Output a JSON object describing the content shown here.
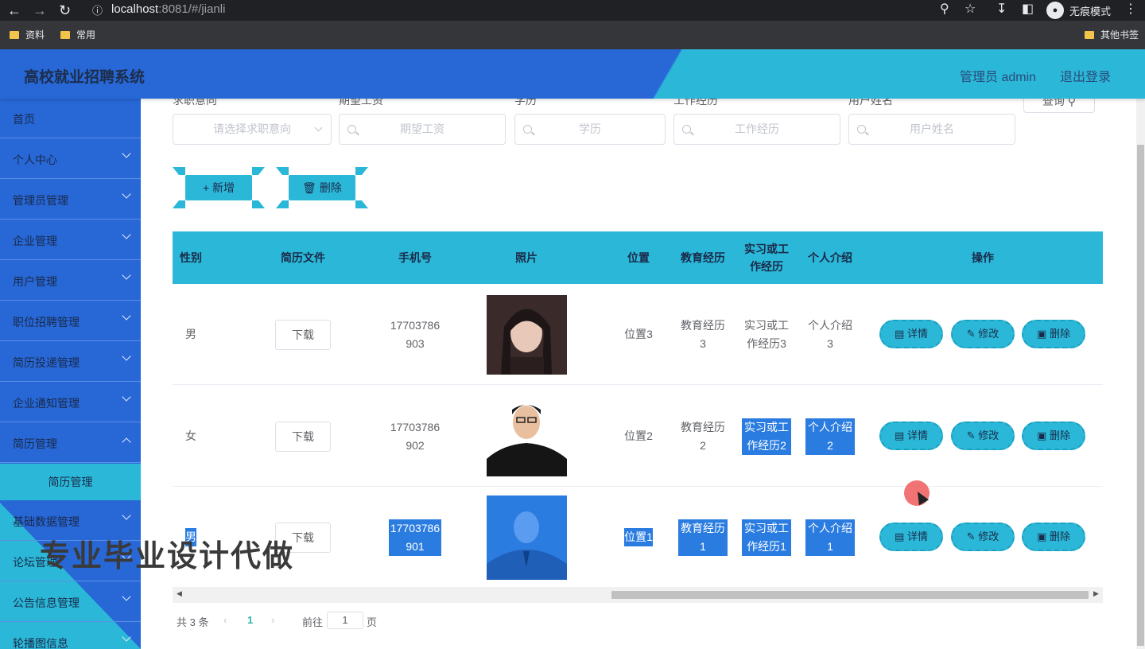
{
  "browser": {
    "url_host": "localhost",
    "url_rest": ":8081/#/jianli",
    "incognito_label": "无痕模式",
    "bookmarks": [
      "资料",
      "常用"
    ],
    "other_bookmarks": "其他书签"
  },
  "header": {
    "title": "高校就业招聘系统",
    "admin_label": "管理员 admin",
    "logout_label": "退出登录"
  },
  "sidebar": {
    "items": [
      {
        "label": "首页"
      },
      {
        "label": "个人中心"
      },
      {
        "label": "管理员管理"
      },
      {
        "label": "企业管理"
      },
      {
        "label": "用户管理"
      },
      {
        "label": "职位招聘管理"
      },
      {
        "label": "简历投递管理"
      },
      {
        "label": "企业通知管理"
      },
      {
        "label": "简历管理"
      },
      {
        "label": "基础数据管理"
      },
      {
        "label": "论坛管理"
      },
      {
        "label": "公告信息管理"
      },
      {
        "label": "轮播图信息"
      }
    ],
    "active_sub": "简历管理"
  },
  "filters": {
    "labels": [
      "求职意向",
      "期望工资",
      "学历",
      "工作经历",
      "用户姓名"
    ],
    "placeholders": [
      "请选择求职意向",
      "期望工资",
      "学历",
      "工作经历",
      "用户姓名"
    ],
    "query_label": "查询"
  },
  "actions": {
    "add_label": "+ 新增",
    "delete_label": "删除"
  },
  "table": {
    "headers": [
      "性别",
      "简历文件",
      "手机号",
      "照片",
      "位置",
      "教育经历",
      "实习或工作经历",
      "个人介绍",
      "操作"
    ],
    "rows": [
      {
        "gender": "男",
        "file": "下载",
        "phone": "17703786903",
        "location": "位置3",
        "edu": "教育经历3",
        "work": "实习或工作经历3",
        "intro": "个人介绍3"
      },
      {
        "gender": "女",
        "file": "下载",
        "phone": "17703786902",
        "location": "位置2",
        "edu": "教育经历2",
        "work": "实习或工作经历2",
        "intro": "个人介绍2"
      },
      {
        "gender": "男",
        "file": "下载",
        "phone": "17703786901",
        "location": "位置1",
        "edu": "教育经历1",
        "work": "实习或工作经历1",
        "intro": "个人介绍1"
      }
    ],
    "op_labels": {
      "detail": "详情",
      "edit": "修改",
      "delete": "删除"
    }
  },
  "pagination": {
    "total_label": "共 3 条",
    "current_page": "1",
    "goto_label": "前往",
    "goto_value": "1",
    "page_suffix": "页"
  },
  "watermark": "专业毕业设计代做",
  "colors": {
    "primary_blue": "#2767d6",
    "accent_cyan": "#2bb8d8",
    "selection": "#2a7ce0"
  }
}
